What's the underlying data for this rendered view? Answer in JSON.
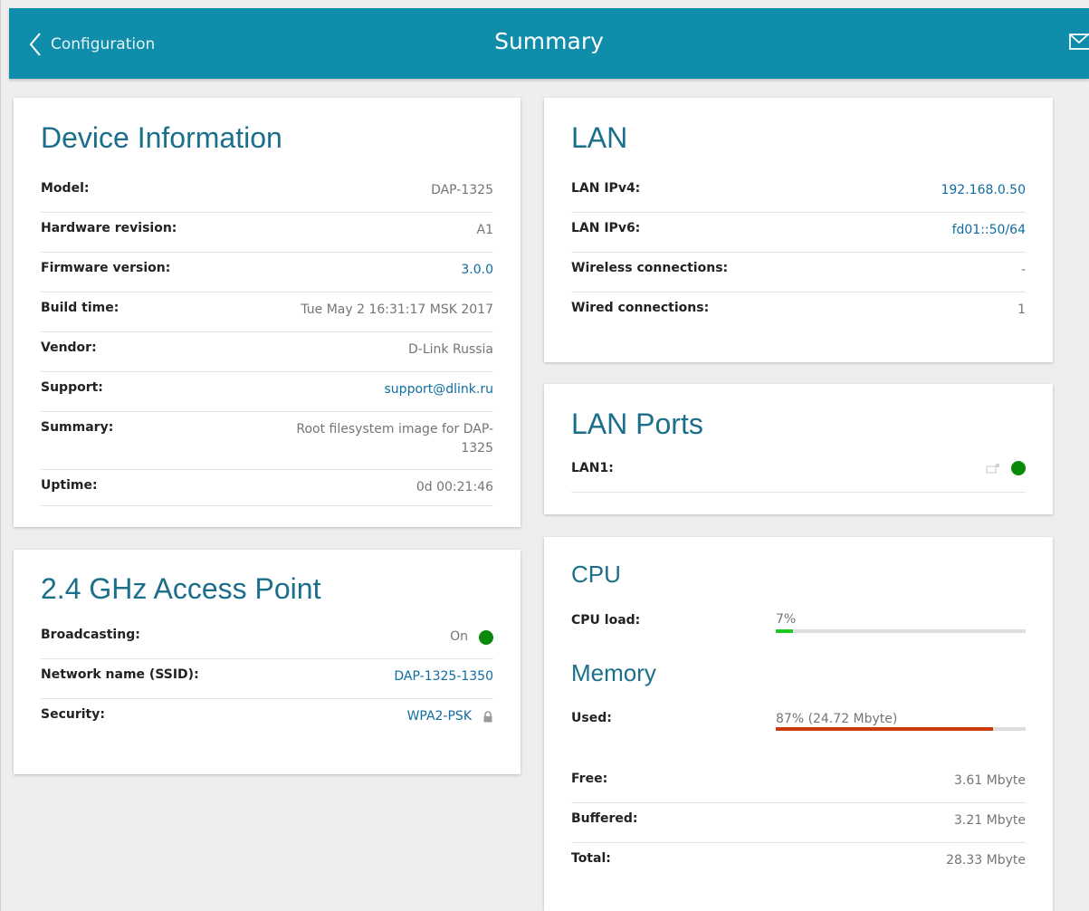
{
  "header": {
    "back_label": "Configuration",
    "title": "Summary"
  },
  "device_info": {
    "title": "Device Information",
    "rows": [
      {
        "label": "Model:",
        "value": "DAP-1325"
      },
      {
        "label": "Hardware revision:",
        "value": "A1"
      },
      {
        "label": "Firmware version:",
        "value": "3.0.0"
      },
      {
        "label": "Build time:",
        "value": "Tue May 2 16:31:17 MSK 2017"
      },
      {
        "label": "Vendor:",
        "value": "D-Link Russia"
      },
      {
        "label": "Support:",
        "value": "support@dlink.ru"
      },
      {
        "label": "Summary:",
        "value": "Root filesystem image for DAP-1325"
      },
      {
        "label": "Uptime:",
        "value": "0d 00:21:46"
      }
    ]
  },
  "access_point": {
    "title": "2.4 GHz Access Point",
    "rows": [
      {
        "label": "Broadcasting:",
        "value": "On"
      },
      {
        "label": "Network name (SSID):",
        "value": "DAP-1325-1350"
      },
      {
        "label": "Security:",
        "value": "WPA2-PSK"
      }
    ]
  },
  "lan": {
    "title": "LAN",
    "rows": [
      {
        "label": "LAN IPv4:",
        "value": "192.168.0.50"
      },
      {
        "label": "LAN IPv6:",
        "value": "fd01::50/64"
      },
      {
        "label": "Wireless connections:",
        "value": "-"
      },
      {
        "label": "Wired connections:",
        "value": "1"
      }
    ]
  },
  "lan_ports": {
    "title": "LAN Ports",
    "rows": [
      {
        "label": "LAN1:"
      }
    ]
  },
  "cpu": {
    "title": "CPU",
    "load_label": "CPU load:",
    "load_text": "7%",
    "load_fraction": 0.07,
    "load_color": "#1ec81e"
  },
  "memory": {
    "title": "Memory",
    "used_label": "Used:",
    "used_text": "87% (24.72 Mbyte)",
    "used_fraction": 0.87,
    "used_color": "#cc3a0a",
    "rows": [
      {
        "label": "Free:",
        "value": "3.61 Mbyte"
      },
      {
        "label": "Buffered:",
        "value": "3.21 Mbyte"
      },
      {
        "label": "Total:",
        "value": "28.33 Mbyte"
      }
    ]
  },
  "colors": {
    "header_bg": "#0f8dab",
    "title_text": "#1b6f8a",
    "link": "#0f6da0",
    "status_on": "#0a8a0a"
  }
}
